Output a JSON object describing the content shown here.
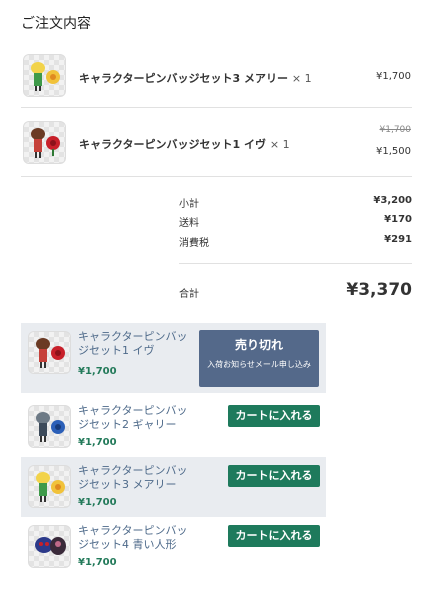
{
  "order_summary": {
    "title": "ご注文内容",
    "items": [
      {
        "name": "キャラクターピンバッジセット3 メアリー",
        "qty": "× 1",
        "price": "¥1,700"
      },
      {
        "name": "キャラクターピンバッジセット1 イヴ",
        "qty": "× 1",
        "original_price": "¥1,700",
        "price": "¥1,500"
      }
    ],
    "subtotal_label": "小計",
    "subtotal": "¥3,200",
    "shipping_label": "送料",
    "shipping": "¥170",
    "tax_label": "消費税",
    "tax": "¥291",
    "total_label": "合計",
    "total": "¥3,370"
  },
  "recommendations": [
    {
      "name": "キャラクターピンバッジセット1 イヴ",
      "price": "¥1,700",
      "status": "sold_out",
      "button": "売り切れ",
      "button_sub": "入荷お知らせメール申し込み"
    },
    {
      "name": "キャラクターピンバッジセット2 ギャリー",
      "price": "¥1,700",
      "button": "カートに入れる"
    },
    {
      "name": "キャラクターピンバッジセット3 メアリー",
      "price": "¥1,700",
      "button": "カートに入れる"
    },
    {
      "name": "キャラクターピンバッジセット4 青い人形",
      "price": "¥1,700",
      "button": "カートに入れる"
    }
  ],
  "colors": {
    "cart_button": "#1e7a5c",
    "sold_out_button": "#54698a",
    "rec_name": "#4e6a8a",
    "rec_price": "#237a5a"
  },
  "icons": [
    "pin-badge-mary-thumbnail",
    "pin-badge-ib-thumbnail",
    "pin-badge-garry-thumbnail",
    "pin-badge-blue-doll-thumbnail"
  ]
}
